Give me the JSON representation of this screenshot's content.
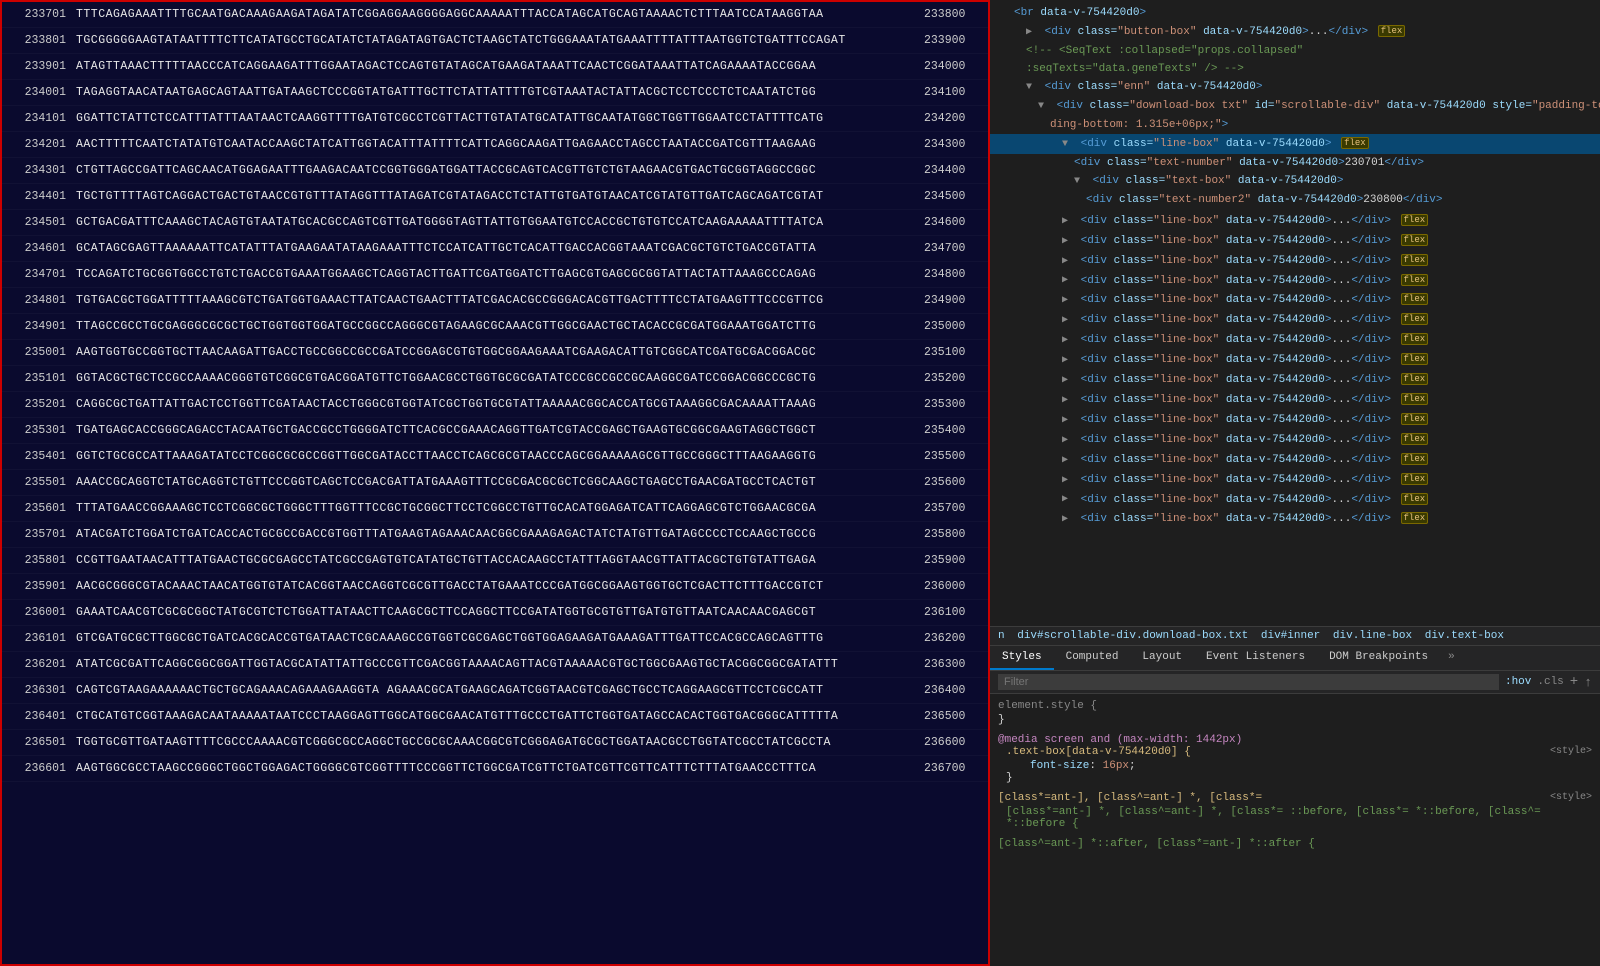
{
  "leftPanel": {
    "borderColor": "#cc0000",
    "lines": [
      {
        "numLeft": "233701",
        "seq": "TTTCAGAGAAATTTTGCAATGACAAAGAAGATAGATATCGGAGGAAGGGGAGGCAAAAATTTACCATAGCATGCAGTAAAACTCTTTAATCCATAAGGTAA",
        "numRight": "233800"
      },
      {
        "numLeft": "233801",
        "seq": "TGCGGGGGAAGTATAATTTTCTTCATATGCCTGCATATCTATAGATAGTGACTCTAAGCTATCTGGGAAATATGAAATTTTATTTAATGGTCTGATTTCCAGAT",
        "numRight": "233900"
      },
      {
        "numLeft": "233901",
        "seq": "ATAGTTAAACTTTTTAACCCATCAGGAAGATTTGGAATAGACTCCAGTGTATAGCATGAAGATAAATTCAACTCGGATAAATTATCAGAAAATACCGGAA",
        "numRight": "234000"
      },
      {
        "numLeft": "234001",
        "seq": "TAGAGGTAACATAATGAGCAGTAATTGATAAGCTCCCGGTATGATTTGCTTCTATTATTTTGTCGTAAATACTATTACGCTCCTCCCTCTCAATATCTGG",
        "numRight": "234100"
      },
      {
        "numLeft": "234101",
        "seq": "GGATTCTATTCTCCATTTATTTAATAACTCAAGGTTTTGATGTCGCCTCGTTACTTGTATATGCATATTGCAATATGGCTGGTTGGAATCCTATTTTCATG",
        "numRight": "234200"
      },
      {
        "numLeft": "234201",
        "seq": "AACTTTTTCAATCTATATGTCAATACCAAGCTATCATTGGTACATTTATTTTCATTCAGGCAAGATTGAGAACCTAGCCTAATACCGATCGTTTAAGAAG",
        "numRight": "234300"
      },
      {
        "numLeft": "234301",
        "seq": "CTGTTAGCCGATTCAGCAACATGGAGAATTTGAAGACAATCCGGTGGGATGGATTACCGCAGTCACGTTGTCTGTAAGAACGTGACTGCGGTAGGCCGGC",
        "numRight": "234400"
      },
      {
        "numLeft": "234401",
        "seq": "TGCTGTTTTAGTCAGGACTGACTGTAACCGTGTTTATAGGTTTATAGATCGTATAGACCTCTATTGTGATGTAACATCGTATGTTGATCAGCAGATCGTAT",
        "numRight": "234500"
      },
      {
        "numLeft": "234501",
        "seq": "GCTGACGATTTCAAAGCTACAGTGTAATATGCACGCCAGTCGTTGATGGGGTAGTTATTGTGGAATGTCCACCGCTGTGTCCATCAAGAAAAATTTTATCA",
        "numRight": "234600"
      },
      {
        "numLeft": "234601",
        "seq": "GCATAGCGAGTTAAAAAATTCATATTTATGAAGAATATAAGAAATTTCTCCATCATTGCTCACATTGACCACGGTAAATCGACGCTGTCTGACCGTATTA",
        "numRight": "234700"
      },
      {
        "numLeft": "234701",
        "seq": "TCCAGATCTGCGGTGGCCTGTCTGACCGTGAAATGGAAGCTCAGGTACTTGATTCGATGGATCTTGAGCGTGAGCGCGGTATTACTATTAAAGCCCAGAG",
        "numRight": "234800"
      },
      {
        "numLeft": "234801",
        "seq": "TGTGACGCTGGATTTTTAAAGCGTCTGATGGTGAAACTTATCAACTGAACTTTATCGACACGCCGGGACACGTTGACTTTTCCTATGAAGTTTCCCGTTCG",
        "numRight": "234900"
      },
      {
        "numLeft": "234901",
        "seq": "TTAGCCGCCTGCGAGGGCGCGCTGCTGGTGGTGGATGCCGGCCAGGGCGTAGAAGCGCAAACGTTGGCGAACTGCTACACCGCGATGGAAATGGATCTTG",
        "numRight": "235000"
      },
      {
        "numLeft": "235001",
        "seq": "AAGTGGTGCCGGTGCTTAACAAGATTGACCTGCCGGCCGCCGATCCGGAGCGTGTGGCGGAAGAAATCGAAGACATTGTCGGCATCGATGCGACGGACGC",
        "numRight": "235100"
      },
      {
        "numLeft": "235101",
        "seq": "GGTACGCTGCTCCGCCAAAACGGGTGTCGGCGTGACGGATGTTCTGGAACGCCTGGTGCGCGATATCCCGCCGCCGCAAGGCGATCCGGACGGCCCGCTG",
        "numRight": "235200"
      },
      {
        "numLeft": "235201",
        "seq": "CAGGCGCTGATTATTGACTCCTGGTTCGATAACTACCTGGGCGTGGTATCGCTGGTGCGTATTAAAAACGGCACCATGCGTAAAGGCGACAAAATTAAAG",
        "numRight": "235300"
      },
      {
        "numLeft": "235301",
        "seq": "TGATGAGCACCGGGCAGACCTACAATGCTGACCGCCTGGGGATCTTCACGCCGAAACAGGTTGATCGTACCGAGCTGAAGTGCGGCGAAGTAGGCTGGCT",
        "numRight": "235400"
      },
      {
        "numLeft": "235401",
        "seq": "GGTCTGCGCCATTAAAGATATCCTCGGCGCGCCGGTTGGCGATACCTTAACCTCAGCGCGTAACCCAGCGGAAAAAGCGTTGCCGGGCTTTAAGAAGGTG",
        "numRight": "235500"
      },
      {
        "numLeft": "235501",
        "seq": "AAACCGCAGGTCTATGCAGGTCTGTTCCCGGTCAGCTCCGACGATTATGAAAGTTTCCGCGACGCGCTCGGCAAGCTGAGCCTGAACGATGCCTCACTGT",
        "numRight": "235600"
      },
      {
        "numLeft": "235601",
        "seq": "TTTATGAACCGGAAAGCTCCTCGGCGCTGGGCTTTGGTTTCCGCTGCGGCTTCCTCGGCCTGTTGCACATGGAGATCATTCAGGAGCGTCTGGAACGCGA",
        "numRight": "235700"
      },
      {
        "numLeft": "235701",
        "seq": "ATACGATCTGGATCTGATCACCACTGCGCCGACCGTGGTTTATGAAGTAGAAACAACGGCGAAAGAGACTATCTATGTTGATAGCCCCTCCAAGCTGCCG",
        "numRight": "235800"
      },
      {
        "numLeft": "235801",
        "seq": "CCGTTGAATAACATTTATGAACTGCGCGAGCCTATCGCCGAGTGTCATATGCTGTTACCACAAGCCTATTTAGGTAACGTTATTACGCTGTGTATTGAGA",
        "numRight": "235900"
      },
      {
        "numLeft": "235901",
        "seq": "AACGCGGGCGTACAAACTAACATGGTGTATCACGGTAACCAGGTCGCGTTGACCTATGAAATCCCGATGGCGGAAGTGGTGCTCGACTTCTTTGACCGTCT",
        "numRight": "236000"
      },
      {
        "numLeft": "236001",
        "seq": "GAAATCAACGTCGCGCGGCTATGCGTCTCTGGATTATAACTTCAAGCGCTTCCAGGCTTCCGATATGGTGCGTGTTGATGTGTTAATCAACAACGAGCGT",
        "numRight": "236100"
      },
      {
        "numLeft": "236101",
        "seq": "GTCGATGCGCTTGGCGCTGATCACGCACCGTGATAACTCGCAAAGCCGTGGTCGCGAGCTGGTGGAGAAGATGAAAGATTTGATTCCACGCCAGCAGTTTG",
        "numRight": "236200"
      },
      {
        "numLeft": "236201",
        "seq": "ATATCGCGATTCAGGCGGCGGATTGGTACGCATATTATTGCCCGTTCGACGGTAAAACAGTTACGTAAAAACGTGCTGGCGAAGTGCTACGGCGGCGATATTT",
        "numRight": "236300"
      },
      {
        "numLeft": "236301",
        "seq": "CAGTCGTAAGAAAAAACTGCTGCAGAAACAGAAAGAAGGTA AGAAACGCATGAAGCAGATCGGTAACGTCGAGCTGCCTCAGGAAGCGTTCCTCGCCATT",
        "numRight": "236400"
      },
      {
        "numLeft": "236401",
        "seq": "CTGCATGTCGGTAAAGACAATAAAAATAATCCCTAAGGAGTTGGCATGGCGAACATGTTTGCCCTGATTCTGGTGATAGCCACACTGGTGACGGGCATTTTTA",
        "numRight": "236500"
      },
      {
        "numLeft": "236501",
        "seq": "TGGTGCGTTGATAAGTTTTCGCCCAAAACGTCGGGCGCCAGGCTGCCGCGCAAACGGCGTCGGGAGATGCGCTGGATAACGCCTGGTATCGCCTATCGCCTA",
        "numRight": "236600"
      },
      {
        "numLeft": "236601",
        "seq": "AAGTGGCGCCTAAGCCGGGCTGGCTGGAGACTGGGGCGTCGGTTTTCCCGGTTCTGGCGATCGTTCTGATCGTTCGTTCATTTCTTTATGAACCCTTTCA",
        "numRight": "236700"
      }
    ]
  },
  "rightPanel": {
    "domTree": {
      "lines": [
        {
          "indent": 1,
          "html": "<span class='dom-tag'>&lt;br</span> <span class='dom-attr-name'>data-v-754420d0</span><span class='dom-tag'>&gt;</span>",
          "id": "br-line"
        },
        {
          "indent": 2,
          "html": "<span class='dom-collapse-arrow'>▶</span> <span class='dom-tag'>&lt;div</span> <span class='dom-attr-name'>class=</span><span class='dom-attr-val'>\"button-box\"</span> <span class='dom-attr-name'>data-v-754420d0</span><span class='dom-tag'>&gt;</span>...<span class='dom-tag'>&lt;/div&gt;</span> <span class='dom-flex-badge'>flex</span>",
          "id": "button-box-div"
        },
        {
          "indent": 2,
          "html": "<span class='dom-comment'>&lt;!-- &lt;SeqText :collapsed=&quot;props.collapsed&quot;</span>",
          "id": "comment1"
        },
        {
          "indent": 2,
          "html": "<span class='dom-comment'>:seqTexts=&quot;data.geneTexts&quot; /&gt; --&gt;</span>",
          "id": "comment2"
        },
        {
          "indent": 2,
          "html": "<span class='dom-collapse-arrow'>▼</span> <span class='dom-tag'>&lt;div</span> <span class='dom-attr-name'>class=</span><span class='dom-attr-val'>\"enn\"</span> <span class='dom-attr-name'>data-v-754420d0</span><span class='dom-tag'>&gt;</span>",
          "id": "enn-div"
        },
        {
          "indent": 3,
          "html": "<span class='dom-collapse-arrow'>▼</span> <span class='dom-tag'>&lt;div</span> <span class='dom-attr-name'>class=</span><span class='dom-attr-val'>\"download-box txt\"</span> <span class='dom-attr-name'>id=</span><span class='dom-attr-val'>\"scrollable-div\"</span> <span class='dom-attr-name'>data-v-754420d0</span> <span class='dom-attr-name'>style=</span><span class='dom-attr-val'>\"padding-top:</span>",
          "id": "download-box-div"
        },
        {
          "indent": 4,
          "html": "<span class='dom-attr-val'>ding-bottom: 1.315e+06px;\"</span><span class='dom-tag'>&gt;</span>",
          "id": "style-cont"
        },
        {
          "indent": 5,
          "html": "<span class='dom-collapse-arrow'>▼</span> <span class='dom-tag'>&lt;div</span> <span class='dom-attr-name'>class=</span><span class='dom-attr-val'>\"line-box\"</span> <span class='dom-attr-name'>data-v-754420d0</span><span class='dom-tag'>&gt;</span> <span class='dom-flex-badge'>flex</span>",
          "id": "line-box-1",
          "selected": true
        },
        {
          "indent": 6,
          "html": "<span class='dom-tag'>&lt;div</span> <span class='dom-attr-name'>class=</span><span class='dom-attr-val'>\"text-number\"</span> <span class='dom-attr-name'>data-v-754420d0</span><span class='dom-tag'>&gt;</span>230701<span class='dom-tag'>&lt;/div&gt;</span>",
          "id": "text-number"
        },
        {
          "indent": 6,
          "html": "<span class='dom-collapse-arrow'>▼</span> <span class='dom-tag'>&lt;div</span> <span class='dom-attr-name'>class=</span><span class='dom-attr-val'>\"text-box\"</span> <span class='dom-attr-name'>data-v-754420d0</span><span class='dom-tag'>&gt;</span>",
          "id": "text-box"
        },
        {
          "indent": 7,
          "html": "<span class='dom-tag'>&lt;div</span> <span class='dom-attr-name'>class=</span><span class='dom-attr-val'>\"text-number2\"</span> <span class='dom-attr-name'>data-v-754420d0</span><span class='dom-tag'>&gt;</span>230800<span class='dom-tag'>&lt;/div&gt;</span>",
          "id": "text-number2"
        },
        {
          "indent": 7,
          "html": "</div>",
          "id": "close-div1"
        },
        {
          "indent": 5,
          "html": "<span class='dom-collapse-arrow'>▶</span> <span class='dom-tag'>&lt;div</span> <span class='dom-attr-name'>class=</span><span class='dom-attr-val'>\"line-box\"</span> <span class='dom-attr-name'>data-v-754420d0</span><span class='dom-tag'>&gt;</span>...<span class='dom-tag'>&lt;/div&gt;</span> <span class='dom-flex-badge'>flex</span>",
          "id": "line-box-2"
        },
        {
          "indent": 5,
          "html": "<span class='dom-collapse-arrow'>▶</span> <span class='dom-tag'>&lt;div</span> <span class='dom-attr-name'>class=</span><span class='dom-attr-val'>\"line-box\"</span> <span class='dom-attr-name'>data-v-754420d0</span><span class='dom-tag'>&gt;</span>...<span class='dom-tag'>&lt;/div&gt;</span> <span class='dom-flex-badge'>flex</span>",
          "id": "line-box-3"
        },
        {
          "indent": 5,
          "html": "<span class='dom-collapse-arrow'>▶</span> <span class='dom-tag'>&lt;div</span> <span class='dom-attr-name'>class=</span><span class='dom-attr-val'>\"line-box\"</span> <span class='dom-attr-name'>data-v-754420d0</span><span class='dom-tag'>&gt;</span>...<span class='dom-tag'>&lt;/div&gt;</span> <span class='dom-flex-badge'>flex</span>",
          "id": "line-box-4"
        },
        {
          "indent": 5,
          "html": "<span class='dom-collapse-arrow'>▶</span> <span class='dom-tag'>&lt;div</span> <span class='dom-attr-name'>class=</span><span class='dom-attr-val'>\"line-box\"</span> <span class='dom-attr-name'>data-v-754420d0</span><span class='dom-tag'>&gt;</span>...<span class='dom-tag'>&lt;/div&gt;</span> <span class='dom-flex-badge'>flex</span>",
          "id": "line-box-5"
        },
        {
          "indent": 5,
          "html": "<span class='dom-collapse-arrow'>▶</span> <span class='dom-tag'>&lt;div</span> <span class='dom-attr-name'>class=</span><span class='dom-attr-val'>\"line-box\"</span> <span class='dom-attr-name'>data-v-754420d0</span><span class='dom-tag'>&gt;</span>...<span class='dom-tag'>&lt;/div&gt;</span> <span class='dom-flex-badge'>flex</span>",
          "id": "line-box-6"
        },
        {
          "indent": 5,
          "html": "<span class='dom-collapse-arrow'>▶</span> <span class='dom-tag'>&lt;div</span> <span class='dom-attr-name'>class=</span><span class='dom-attr-val'>\"line-box\"</span> <span class='dom-attr-name'>data-v-754420d0</span><span class='dom-tag'>&gt;</span>...<span class='dom-tag'>&lt;/div&gt;</span> <span class='dom-flex-badge'>flex</span>",
          "id": "line-box-7"
        },
        {
          "indent": 5,
          "html": "<span class='dom-collapse-arrow'>▶</span> <span class='dom-tag'>&lt;div</span> <span class='dom-attr-name'>class=</span><span class='dom-attr-val'>\"line-box\"</span> <span class='dom-attr-name'>data-v-754420d0</span><span class='dom-tag'>&gt;</span>...<span class='dom-tag'>&lt;/div&gt;</span> <span class='dom-flex-badge'>flex</span>",
          "id": "line-box-8"
        },
        {
          "indent": 5,
          "html": "<span class='dom-collapse-arrow'>▶</span> <span class='dom-tag'>&lt;div</span> <span class='dom-attr-name'>class=</span><span class='dom-attr-val'>\"line-box\"</span> <span class='dom-attr-name'>data-v-754420d0</span><span class='dom-tag'>&gt;</span>...<span class='dom-tag'>&lt;/div&gt;</span> <span class='dom-flex-badge'>flex</span>",
          "id": "line-box-9"
        },
        {
          "indent": 5,
          "html": "<span class='dom-collapse-arrow'>▶</span> <span class='dom-tag'>&lt;div</span> <span class='dom-attr-name'>class=</span><span class='dom-attr-val'>\"line-box\"</span> <span class='dom-attr-name'>data-v-754420d0</span><span class='dom-tag'>&gt;</span>...<span class='dom-tag'>&lt;/div&gt;</span> <span class='dom-flex-badge'>flex</span>",
          "id": "line-box-10"
        },
        {
          "indent": 5,
          "html": "<span class='dom-collapse-arrow'>▶</span> <span class='dom-tag'>&lt;div</span> <span class='dom-attr-name'>class=</span><span class='dom-attr-val'>\"line-box\"</span> <span class='dom-attr-name'>data-v-754420d0</span><span class='dom-tag'>&gt;</span>...<span class='dom-tag'>&lt;/div&gt;</span> <span class='dom-flex-badge'>flex</span>",
          "id": "line-box-11"
        },
        {
          "indent": 5,
          "html": "<span class='dom-collapse-arrow'>▶</span> <span class='dom-tag'>&lt;div</span> <span class='dom-attr-name'>class=</span><span class='dom-attr-val'>\"line-box\"</span> <span class='dom-attr-name'>data-v-754420d0</span><span class='dom-tag'>&gt;</span>...<span class='dom-tag'>&lt;/div&gt;</span> <span class='dom-flex-badge'>flex</span>",
          "id": "line-box-12"
        },
        {
          "indent": 5,
          "html": "<span class='dom-collapse-arrow'>▶</span> <span class='dom-tag'>&lt;div</span> <span class='dom-attr-name'>class=</span><span class='dom-attr-val'>\"line-box\"</span> <span class='dom-attr-name'>data-v-754420d0</span><span class='dom-tag'>&gt;</span>...<span class='dom-tag'>&lt;/div&gt;</span> <span class='dom-flex-badge'>flex</span>",
          "id": "line-box-13"
        },
        {
          "indent": 5,
          "html": "<span class='dom-collapse-arrow'>▶</span> <span class='dom-tag'>&lt;div</span> <span class='dom-attr-name'>class=</span><span class='dom-attr-val'>\"line-box\"</span> <span class='dom-attr-name'>data-v-754420d0</span><span class='dom-tag'>&gt;</span>...<span class='dom-tag'>&lt;/div&gt;</span> <span class='dom-flex-badge'>flex</span>",
          "id": "line-box-14"
        },
        {
          "indent": 5,
          "html": "<span class='dom-collapse-arrow'>▶</span> <span class='dom-tag'>&lt;div</span> <span class='dom-attr-name'>class=</span><span class='dom-attr-val'>\"line-box\"</span> <span class='dom-attr-name'>data-v-754420d0</span><span class='dom-tag'>&gt;</span>...<span class='dom-tag'>&lt;/div&gt;</span> <span class='dom-flex-badge'>flex</span>",
          "id": "line-box-15"
        },
        {
          "indent": 5,
          "html": "<span class='dom-collapse-arrow'>▶</span> <span class='dom-tag'>&lt;div</span> <span class='dom-attr-name'>class=</span><span class='dom-attr-val'>\"line-box\"</span> <span class='dom-attr-name'>data-v-754420d0</span><span class='dom-tag'>&gt;</span>...<span class='dom-tag'>&lt;/div&gt;</span> <span class='dom-flex-badge'>flex</span>",
          "id": "line-box-16"
        },
        {
          "indent": 5,
          "html": "<span class='dom-collapse-arrow'>▶</span> <span class='dom-tag'>&lt;div</span> <span class='dom-attr-name'>class=</span><span class='dom-attr-val'>\"line-box\"</span> <span class='dom-attr-name'>data-v-754420d0</span><span class='dom-tag'>&gt;</span>...<span class='dom-tag'>&lt;/div&gt;</span> <span class='dom-flex-badge'>flex</span>",
          "id": "line-box-last"
        }
      ]
    },
    "breadcrumb": {
      "items": [
        "n",
        "div#scrollable-div.download-box.txt",
        "div#inner",
        "div.line-box",
        "div.text-box"
      ]
    },
    "stylesTabs": {
      "tabs": [
        "Styles",
        "Computed",
        "Layout",
        "Event Listeners",
        "DOM Breakpoints"
      ],
      "activeTab": "Styles",
      "more": "»"
    },
    "filter": {
      "placeholder": "Filter",
      "hov": ":hov",
      "cls": ".cls",
      "plus": "+",
      "arrow": "↑"
    },
    "stylesContent": {
      "elementStyle": {
        "label": "element.style {",
        "close": "}",
        "props": []
      },
      "mediaRule": {
        "selector": "@media screen and (max-width: 1442px)",
        "subSelector": ".text-box[data-v-754420d0] {",
        "props": [
          {
            "name": "font-size",
            "value": "16px"
          }
        ],
        "close": "}",
        "file": "<style>"
      },
      "ancestorRules": [
        {
          "selector": "[class*=ant-], [class^=ant-] *, [class*=",
          "file": "<style>",
          "props": [],
          "comment": "[class*=ant-] *, [class^=ant-] *, [class*= ::before, [class*= *::before, [class^= *::before {",
          "comment2": "[class^=ant-] *::after, [class*=ant-] *::after {"
        }
      ]
    }
  }
}
